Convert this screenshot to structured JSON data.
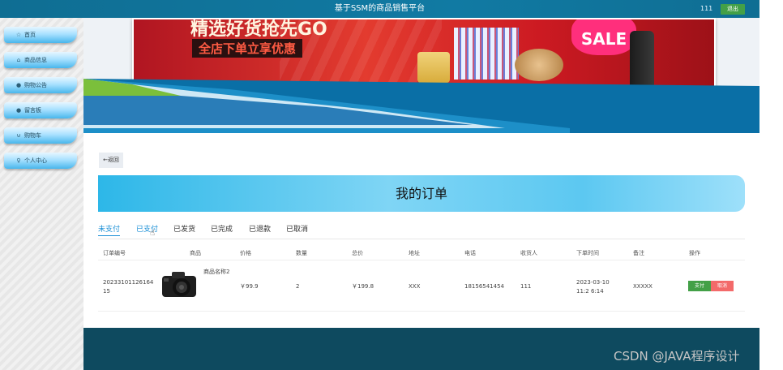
{
  "header": {
    "title": "基于SSM的商品销售平台",
    "username": "111",
    "logout_label": "退出"
  },
  "sidebar": {
    "items": [
      {
        "label": "首页",
        "icon": "☆"
      },
      {
        "label": "商品信息",
        "icon": "⌂"
      },
      {
        "label": "购物公告",
        "icon": "●"
      },
      {
        "label": "留言板",
        "icon": "●"
      },
      {
        "label": "购物车",
        "icon": "⊍"
      },
      {
        "label": "个人中心",
        "icon": "♀"
      }
    ]
  },
  "banner": {
    "headline": "精选好货抢先GO",
    "subline": "全店下单立享优惠",
    "badge": "SALE"
  },
  "page": {
    "back_label": "←返回",
    "title": "我的订单"
  },
  "tabs": [
    "未支付",
    "已支付",
    "已发货",
    "已完成",
    "已退款",
    "已取消"
  ],
  "table": {
    "headers": [
      "订单编号",
      "商品",
      "价格",
      "数量",
      "总价",
      "地址",
      "电话",
      "收货人",
      "下单时间",
      "备注",
      "操作"
    ],
    "rows": [
      {
        "order_no": "20233101126164 15",
        "product_name": "商品名称2",
        "price": "￥99.9",
        "quantity": "2",
        "total": "￥199.8",
        "address": "XXX",
        "phone": "18156541454",
        "receiver": "111",
        "time": "2023-03-10 11:2 6:14",
        "remark": "XXXXX",
        "pay_label": "支付",
        "cancel_label": "取消"
      }
    ]
  },
  "watermark": "CSDN @JAVA程序设计",
  "colors": {
    "topbar": "#117aa3",
    "accent": "#1a8fd6",
    "pay": "#43a047",
    "cancel": "#f36a6a",
    "footer": "#0e4a5f"
  }
}
